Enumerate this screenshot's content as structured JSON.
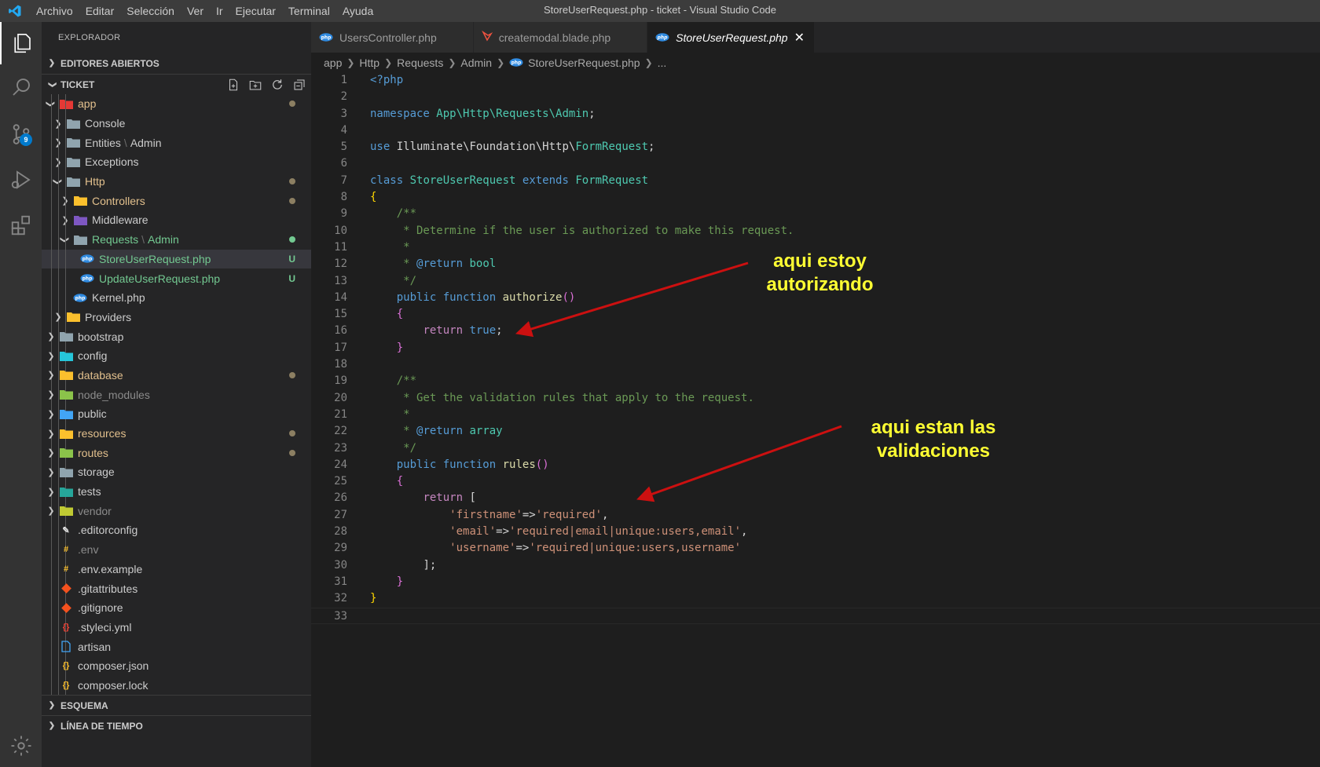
{
  "window": {
    "title": "StoreUserRequest.php - ticket - Visual Studio Code",
    "menu": [
      "Archivo",
      "Editar",
      "Selección",
      "Ver",
      "Ir",
      "Ejecutar",
      "Terminal",
      "Ayuda"
    ]
  },
  "activity_bar": {
    "items": [
      "files-icon",
      "search-icon",
      "source-control-icon",
      "run-debug-icon",
      "extensions-icon",
      "settings-gear-icon"
    ],
    "source_control_badge": "9"
  },
  "sidebar": {
    "title": "EXPLORADOR",
    "open_editors": "EDITORES ABIERTOS",
    "project": "TICKET",
    "outline": "ESQUEMA",
    "timeline": "LÍNEA DE TIEMPO",
    "tree": [
      {
        "label": "app",
        "indent": 1,
        "chev": "open",
        "icon": "folder-app",
        "color": "mod",
        "dot": true
      },
      {
        "label": "Console",
        "indent": 2,
        "chev": "closed",
        "icon": "folder"
      },
      {
        "label": "Entities",
        "suffix": "Admin",
        "indent": 2,
        "chev": "closed",
        "icon": "folder"
      },
      {
        "label": "Exceptions",
        "indent": 2,
        "chev": "closed",
        "icon": "folder"
      },
      {
        "label": "Http",
        "indent": 2,
        "chev": "open",
        "icon": "folder-open",
        "color": "mod",
        "dot": true
      },
      {
        "label": "Controllers",
        "indent": 3,
        "chev": "closed",
        "icon": "folder-yellow",
        "color": "mod",
        "dot": true
      },
      {
        "label": "Middleware",
        "indent": 3,
        "chev": "closed",
        "icon": "folder-purple"
      },
      {
        "label": "Requests",
        "suffix": "Admin",
        "indent": 3,
        "chev": "open",
        "icon": "folder-open",
        "color": "added",
        "dotgreen": true
      },
      {
        "label": "StoreUserRequest.php",
        "indent": 4,
        "icon": "php",
        "color": "added",
        "deco": "U",
        "selected": true
      },
      {
        "label": "UpdateUserRequest.php",
        "indent": 4,
        "icon": "php",
        "color": "added",
        "deco": "U"
      },
      {
        "label": "Kernel.php",
        "indent": 3,
        "icon": "php"
      },
      {
        "label": "Providers",
        "indent": 2,
        "chev": "closed",
        "icon": "folder-yellow"
      },
      {
        "label": "bootstrap",
        "indent": 1,
        "chev": "closed",
        "icon": "folder"
      },
      {
        "label": "config",
        "indent": 1,
        "chev": "closed",
        "icon": "folder-config"
      },
      {
        "label": "database",
        "indent": 1,
        "chev": "closed",
        "icon": "folder-yellow",
        "color": "mod",
        "dot": true
      },
      {
        "label": "node_modules",
        "indent": 1,
        "chev": "closed",
        "icon": "folder-green",
        "dim": true
      },
      {
        "label": "public",
        "indent": 1,
        "chev": "closed",
        "icon": "folder-blue"
      },
      {
        "label": "resources",
        "indent": 1,
        "chev": "closed",
        "icon": "folder-yellow",
        "color": "mod",
        "dot": true
      },
      {
        "label": "routes",
        "indent": 1,
        "chev": "closed",
        "icon": "folder-green",
        "color": "mod",
        "dot": true
      },
      {
        "label": "storage",
        "indent": 1,
        "chev": "closed",
        "icon": "folder"
      },
      {
        "label": "tests",
        "indent": 1,
        "chev": "closed",
        "icon": "folder-teal"
      },
      {
        "label": "vendor",
        "indent": 1,
        "chev": "closed",
        "icon": "folder-lime",
        "dim": true
      },
      {
        "label": ".editorconfig",
        "indent": 1,
        "icon": "editorconfig"
      },
      {
        "label": ".env",
        "indent": 1,
        "icon": "env",
        "dim": true
      },
      {
        "label": ".env.example",
        "indent": 1,
        "icon": "env"
      },
      {
        "label": ".gitattributes",
        "indent": 1,
        "icon": "git"
      },
      {
        "label": ".gitignore",
        "indent": 1,
        "icon": "git"
      },
      {
        "label": ".styleci.yml",
        "indent": 1,
        "icon": "yml"
      },
      {
        "label": "artisan",
        "indent": 1,
        "icon": "file"
      },
      {
        "label": "composer.json",
        "indent": 1,
        "icon": "json"
      },
      {
        "label": "composer.lock",
        "indent": 1,
        "icon": "json"
      }
    ]
  },
  "tabs": [
    {
      "label": "UsersController.php",
      "icon": "php",
      "active": false
    },
    {
      "label": "createmodal.blade.php",
      "icon": "blade",
      "active": false
    },
    {
      "label": "StoreUserRequest.php",
      "icon": "php",
      "active": true
    }
  ],
  "breadcrumb": [
    "app",
    "Http",
    "Requests",
    "Admin",
    "StoreUserRequest.php",
    "..."
  ],
  "code": [
    [
      [
        "tag",
        "<?php"
      ]
    ],
    [],
    [
      [
        "k",
        "namespace"
      ],
      [
        "pl",
        " "
      ],
      [
        "ns",
        "App\\Http\\Requests\\Admin"
      ],
      [
        "pl",
        ";"
      ]
    ],
    [],
    [
      [
        "k",
        "use"
      ],
      [
        "pl",
        " Illuminate\\Foundation\\Http\\"
      ],
      [
        "cls",
        "FormRequest"
      ],
      [
        "pl",
        ";"
      ]
    ],
    [],
    [
      [
        "k",
        "class"
      ],
      [
        "pl",
        " "
      ],
      [
        "cls",
        "StoreUserRequest"
      ],
      [
        "pl",
        " "
      ],
      [
        "k",
        "extends"
      ],
      [
        "pl",
        " "
      ],
      [
        "cls",
        "FormRequest"
      ]
    ],
    [
      [
        "br1",
        "{"
      ]
    ],
    [
      [
        "pl",
        "    "
      ],
      [
        "cm",
        "/**"
      ]
    ],
    [
      [
        "pl",
        "    "
      ],
      [
        "cm",
        " * Determine if the user is authorized to make this request."
      ]
    ],
    [
      [
        "pl",
        "    "
      ],
      [
        "cm",
        " *"
      ]
    ],
    [
      [
        "pl",
        "    "
      ],
      [
        "cm",
        " * "
      ],
      [
        "ann",
        "@return"
      ],
      [
        "pl",
        " "
      ],
      [
        "typ",
        "bool"
      ]
    ],
    [
      [
        "pl",
        "    "
      ],
      [
        "cm",
        " */"
      ]
    ],
    [
      [
        "pl",
        "    "
      ],
      [
        "k",
        "public"
      ],
      [
        "pl",
        " "
      ],
      [
        "k",
        "function"
      ],
      [
        "pl",
        " "
      ],
      [
        "fn",
        "authorize"
      ],
      [
        "br2",
        "()"
      ]
    ],
    [
      [
        "pl",
        "    "
      ],
      [
        "br2",
        "{"
      ]
    ],
    [
      [
        "pl",
        "        "
      ],
      [
        "kw",
        "return"
      ],
      [
        "pl",
        " "
      ],
      [
        "k",
        "true"
      ],
      [
        "pl",
        ";"
      ]
    ],
    [
      [
        "pl",
        "    "
      ],
      [
        "br2",
        "}"
      ]
    ],
    [],
    [
      [
        "pl",
        "    "
      ],
      [
        "cm",
        "/**"
      ]
    ],
    [
      [
        "pl",
        "    "
      ],
      [
        "cm",
        " * Get the validation rules that apply to the request."
      ]
    ],
    [
      [
        "pl",
        "    "
      ],
      [
        "cm",
        " *"
      ]
    ],
    [
      [
        "pl",
        "    "
      ],
      [
        "cm",
        " * "
      ],
      [
        "ann",
        "@return"
      ],
      [
        "pl",
        " "
      ],
      [
        "typ",
        "array"
      ]
    ],
    [
      [
        "pl",
        "    "
      ],
      [
        "cm",
        " */"
      ]
    ],
    [
      [
        "pl",
        "    "
      ],
      [
        "k",
        "public"
      ],
      [
        "pl",
        " "
      ],
      [
        "k",
        "function"
      ],
      [
        "pl",
        " "
      ],
      [
        "fn",
        "rules"
      ],
      [
        "br2",
        "()"
      ]
    ],
    [
      [
        "pl",
        "    "
      ],
      [
        "br2",
        "{"
      ]
    ],
    [
      [
        "pl",
        "        "
      ],
      [
        "kw",
        "return"
      ],
      [
        "pl",
        " "
      ],
      [
        "pl",
        "["
      ]
    ],
    [
      [
        "pl",
        "            "
      ],
      [
        "str",
        "'firstname'"
      ],
      [
        "pl",
        "=>"
      ],
      [
        "str",
        "'required'"
      ],
      [
        "pl",
        ","
      ]
    ],
    [
      [
        "pl",
        "            "
      ],
      [
        "str",
        "'email'"
      ],
      [
        "pl",
        "=>"
      ],
      [
        "str",
        "'required|email|unique:users,email'"
      ],
      [
        "pl",
        ","
      ]
    ],
    [
      [
        "pl",
        "            "
      ],
      [
        "str",
        "'username'"
      ],
      [
        "pl",
        "=>"
      ],
      [
        "str",
        "'required|unique:users,username'"
      ]
    ],
    [
      [
        "pl",
        "        "
      ],
      [
        "pl",
        "];"
      ]
    ],
    [
      [
        "pl",
        "    "
      ],
      [
        "br2",
        "}"
      ]
    ],
    [
      [
        "br1",
        "}"
      ]
    ],
    []
  ],
  "annotations": {
    "note1": [
      "aqui estoy",
      "autorizando"
    ],
    "note2": [
      "aqui estan las",
      "validaciones"
    ]
  },
  "colors": {
    "arrow": "#cc1010",
    "note": "#ffff33",
    "accent": "#007acc"
  }
}
